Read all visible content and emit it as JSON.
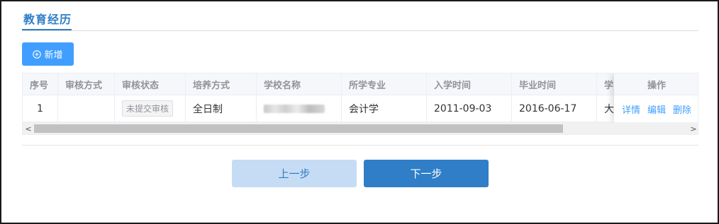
{
  "section": {
    "title": "教育经历"
  },
  "toolbar": {
    "add_label": "新增"
  },
  "table": {
    "headers": {
      "index": "序号",
      "audit_method": "审核方式",
      "audit_status": "审核状态",
      "study_mode": "培养方式",
      "school_name": "学校名称",
      "major": "所学专业",
      "start_date": "入学时间",
      "end_date": "毕业时间",
      "degree": "学",
      "actions": "操作"
    },
    "rows": [
      {
        "index": "1",
        "audit_method": "",
        "audit_status": "未提交审核",
        "study_mode": "全日制",
        "school_name": "",
        "major": "会计学",
        "start_date": "2011-09-03",
        "end_date": "2016-06-17",
        "degree": "大",
        "actions": {
          "detail": "详情",
          "edit": "编辑",
          "delete": "删除"
        }
      }
    ]
  },
  "scrollbar": {
    "left_arrow": "<",
    "right_arrow": ">"
  },
  "nav": {
    "prev_label": "上一步",
    "next_label": "下一步"
  },
  "colors": {
    "primary": "#2f7ec7",
    "add_button": "#409eff",
    "prev_button": "#c6dcf5"
  }
}
